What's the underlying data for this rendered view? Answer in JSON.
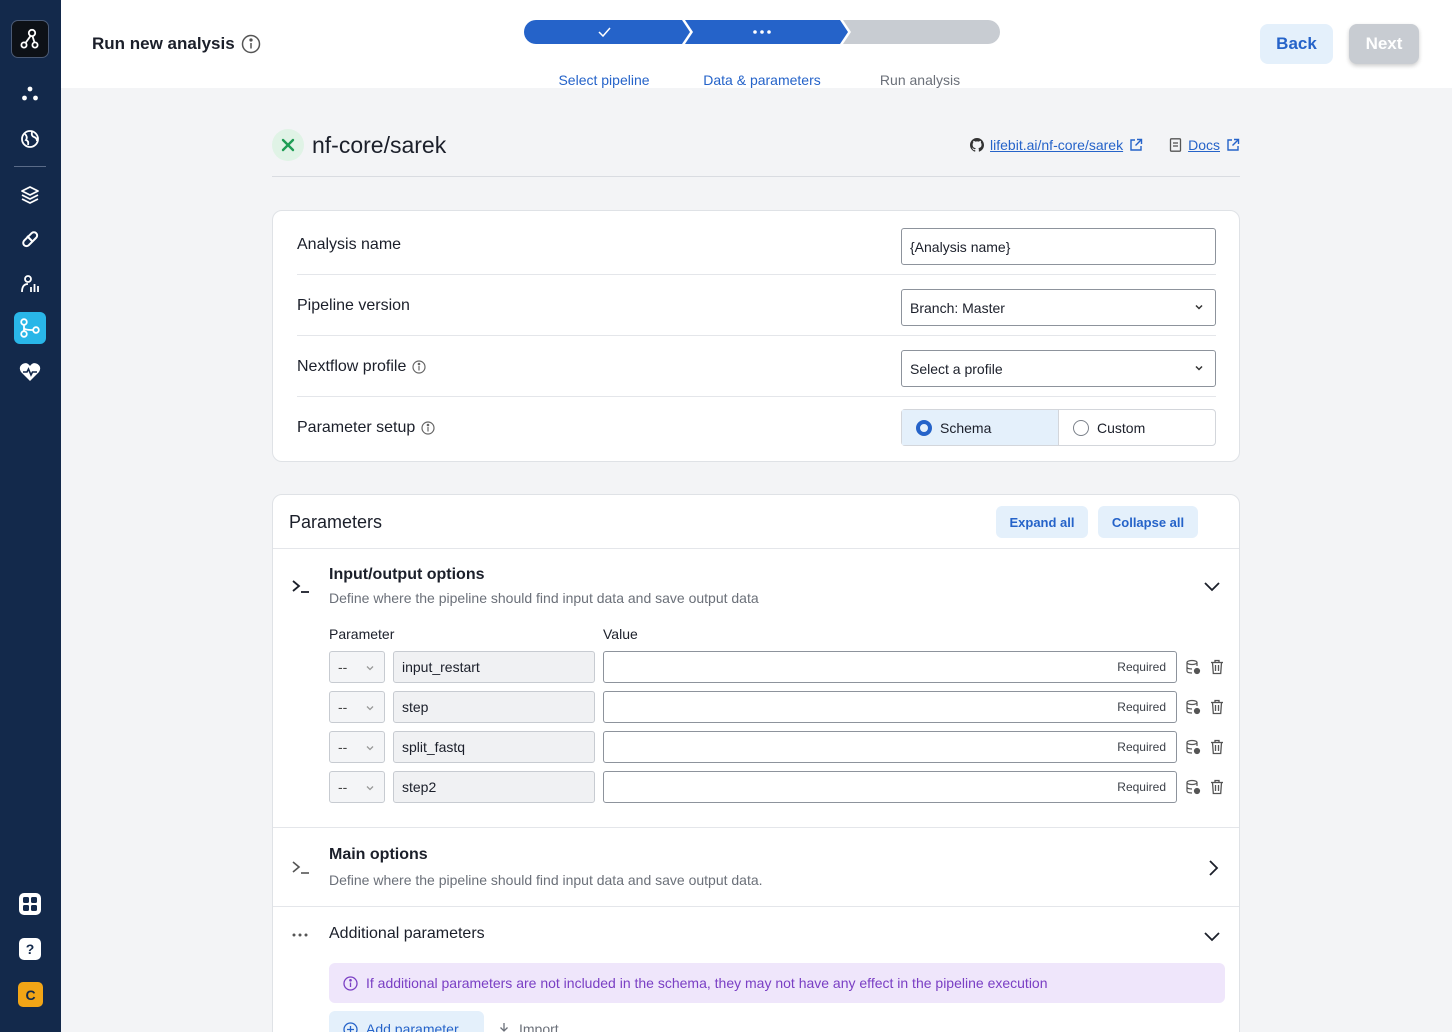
{
  "header": {
    "title": "Run new analysis",
    "back_label": "Back",
    "next_label": "Next",
    "steps": [
      {
        "label": "Select pipeline",
        "state": "complete"
      },
      {
        "label": "Data & parameters",
        "state": "current"
      },
      {
        "label": "Run analysis",
        "state": "pending"
      }
    ]
  },
  "sidebar": {
    "items": [
      {
        "icon": "nodes-icon"
      },
      {
        "icon": "globe-icon"
      },
      {
        "icon": "layers-icon"
      },
      {
        "icon": "pill-icon"
      },
      {
        "icon": "analytics-icon"
      },
      {
        "icon": "pipeline-icon",
        "active": true
      },
      {
        "icon": "heart-icon"
      }
    ],
    "bottom": [
      {
        "icon": "apps-grid-icon"
      },
      {
        "icon": "help-icon"
      }
    ],
    "avatar_initial": "C"
  },
  "pipeline": {
    "name": "nf-core/sarek",
    "repo_link": "lifebit.ai/nf-core/sarek",
    "docs_link": "Docs"
  },
  "form": {
    "analysis_name": {
      "label": "Analysis name",
      "value": "{Analysis name}"
    },
    "pipeline_version": {
      "label": "Pipeline version",
      "value": "Branch: Master"
    },
    "nextflow_profile": {
      "label": "Nextflow profile",
      "value": "Select a profile"
    },
    "parameter_setup": {
      "label": "Parameter setup",
      "options": [
        "Schema",
        "Custom"
      ],
      "selected": "Schema"
    }
  },
  "parameters": {
    "title": "Parameters",
    "expand_all": "Expand all",
    "collapse_all": "Collapse all",
    "sections": [
      {
        "title": "Input/output options",
        "description": "Define where the pipeline should find input data and save output data",
        "expanded": true,
        "col_parameter": "Parameter",
        "col_value": "Value",
        "rows": [
          {
            "selector": "--",
            "name": "input_restart",
            "value": "",
            "badge": "Required"
          },
          {
            "selector": "--",
            "name": "step",
            "value": "",
            "badge": "Required"
          },
          {
            "selector": "--",
            "name": "split_fastq",
            "value": "",
            "badge": "Required"
          },
          {
            "selector": "--",
            "name": "step2",
            "value": "",
            "badge": "Required"
          }
        ]
      },
      {
        "title": "Main options",
        "description": "Define where the pipeline should find input data and save output data.",
        "expanded": false
      },
      {
        "title": "Additional parameters",
        "expanded": true,
        "notice": "If additional parameters are not included in the schema, they may not have any effect in the pipeline execution",
        "add_label": "Add parameter",
        "import_label": "Import"
      }
    ]
  },
  "colors": {
    "sidebar_bg": "#13294b",
    "accent_blue": "#2563c9",
    "active_cyan": "#29b6e8",
    "stepper_pending": "#c8ccd2",
    "notice_purple": "#7a3fc4",
    "avatar_orange": "#f2a516"
  }
}
